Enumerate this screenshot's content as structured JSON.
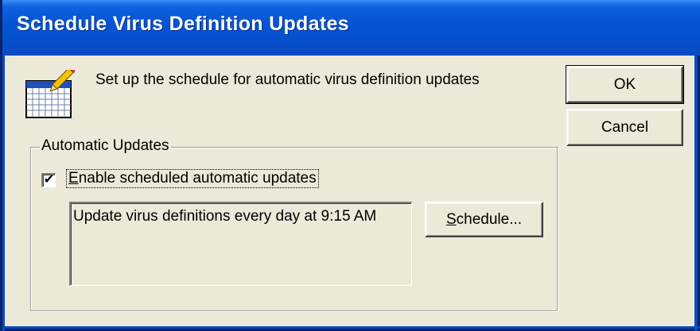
{
  "window": {
    "title": "Schedule Virus Definition Updates"
  },
  "header": {
    "icon": "calendar-edit-icon",
    "description": "Set up the schedule for automatic virus definition updates"
  },
  "buttons": {
    "ok_label": "OK",
    "cancel_label": "Cancel",
    "schedule_label_prefix": "S",
    "schedule_label_rest": "chedule..."
  },
  "automatic_updates": {
    "group_label": "Automatic Updates",
    "enable_checked": true,
    "enable_check_glyph": "✔",
    "enable_label_prefix": "E",
    "enable_label_rest": "nable scheduled automatic updates",
    "schedule_summary": "Update virus definitions every day at 9:15 AM"
  },
  "colors": {
    "titlebar": "#0754d4",
    "dialog_bg": "#ece9d8"
  }
}
